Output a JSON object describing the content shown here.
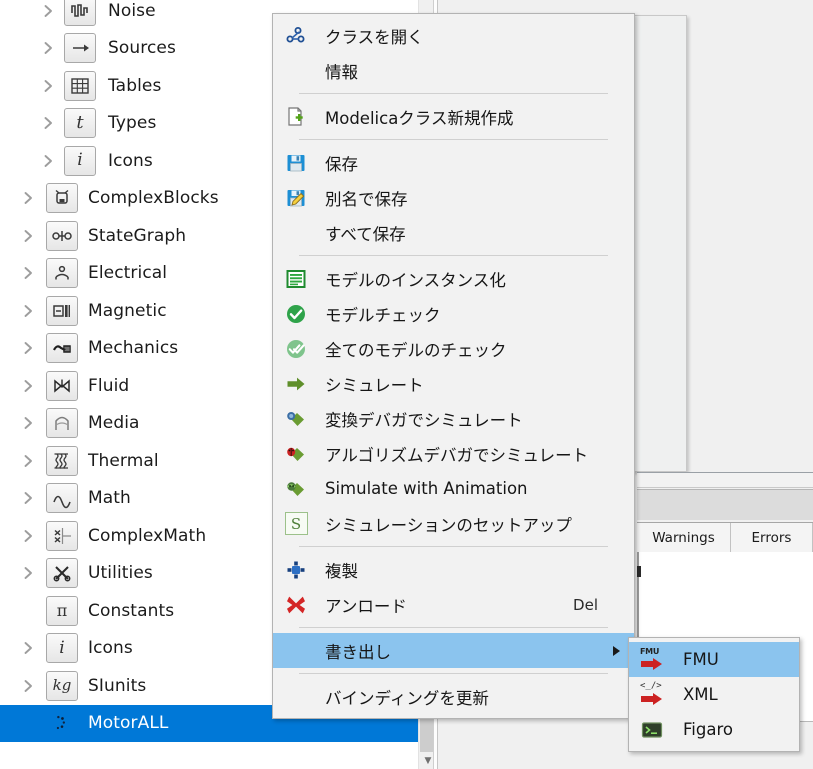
{
  "tree": {
    "items": [
      {
        "label": "Noise",
        "icon": "noise-icon",
        "level": 2,
        "expandable": true,
        "selected": false
      },
      {
        "label": "Sources",
        "icon": "sources-icon",
        "level": 2,
        "expandable": true,
        "selected": false
      },
      {
        "label": "Tables",
        "icon": "tables-icon",
        "level": 2,
        "expandable": true,
        "selected": false
      },
      {
        "label": "Types",
        "icon": "types-icon",
        "level": 2,
        "expandable": true,
        "selected": false
      },
      {
        "label": "Icons",
        "icon": "info-icon",
        "level": 2,
        "expandable": true,
        "selected": false
      },
      {
        "label": "ComplexBlocks",
        "icon": "complexblocks-icon",
        "level": 1,
        "expandable": true,
        "selected": false
      },
      {
        "label": "StateGraph",
        "icon": "stategraph-icon",
        "level": 1,
        "expandable": true,
        "selected": false
      },
      {
        "label": "Electrical",
        "icon": "electrical-icon",
        "level": 1,
        "expandable": true,
        "selected": false
      },
      {
        "label": "Magnetic",
        "icon": "magnetic-icon",
        "level": 1,
        "expandable": true,
        "selected": false
      },
      {
        "label": "Mechanics",
        "icon": "mechanics-icon",
        "level": 1,
        "expandable": true,
        "selected": false
      },
      {
        "label": "Fluid",
        "icon": "fluid-icon",
        "level": 1,
        "expandable": true,
        "selected": false
      },
      {
        "label": "Media",
        "icon": "media-icon",
        "level": 1,
        "expandable": true,
        "selected": false
      },
      {
        "label": "Thermal",
        "icon": "thermal-icon",
        "level": 1,
        "expandable": true,
        "selected": false
      },
      {
        "label": "Math",
        "icon": "math-icon",
        "level": 1,
        "expandable": true,
        "selected": false
      },
      {
        "label": "ComplexMath",
        "icon": "complexmath-icon",
        "level": 1,
        "expandable": true,
        "selected": false
      },
      {
        "label": "Utilities",
        "icon": "utilities-icon",
        "level": 1,
        "expandable": true,
        "selected": false
      },
      {
        "label": "Constants",
        "icon": "pi-icon",
        "level": 1,
        "expandable": false,
        "selected": false
      },
      {
        "label": "Icons",
        "icon": "info-icon",
        "level": 1,
        "expandable": true,
        "selected": false
      },
      {
        "label": "SIunits",
        "icon": "kg-icon",
        "level": 1,
        "expandable": true,
        "selected": false
      },
      {
        "label": "MotorALL",
        "icon": "busy-icon",
        "level": 1,
        "expandable": false,
        "selected": true
      }
    ]
  },
  "context_menu": {
    "items": [
      {
        "type": "item",
        "label": "クラスを開く",
        "icon": "open-class-icon",
        "shortcut": "",
        "submenu": false,
        "highlighted": false
      },
      {
        "type": "item",
        "label": "情報",
        "icon": "none",
        "shortcut": "",
        "submenu": false,
        "highlighted": false
      },
      {
        "type": "separator"
      },
      {
        "type": "item",
        "label": "Modelicaクラス新規作成",
        "icon": "new-modelica-class-icon",
        "shortcut": "",
        "submenu": false,
        "highlighted": false
      },
      {
        "type": "separator"
      },
      {
        "type": "item",
        "label": "保存",
        "icon": "save-icon",
        "shortcut": "",
        "submenu": false,
        "highlighted": false
      },
      {
        "type": "item",
        "label": "別名で保存",
        "icon": "save-as-icon",
        "shortcut": "",
        "submenu": false,
        "highlighted": false
      },
      {
        "type": "item",
        "label": "すべて保存",
        "icon": "none",
        "shortcut": "",
        "submenu": false,
        "highlighted": false
      },
      {
        "type": "separator"
      },
      {
        "type": "item",
        "label": "モデルのインスタンス化",
        "icon": "instantiate-model-icon",
        "shortcut": "",
        "submenu": false,
        "highlighted": false
      },
      {
        "type": "item",
        "label": "モデルチェック",
        "icon": "check-model-icon",
        "shortcut": "",
        "submenu": false,
        "highlighted": false
      },
      {
        "type": "item",
        "label": "全てのモデルのチェック",
        "icon": "check-all-models-icon",
        "shortcut": "",
        "submenu": false,
        "highlighted": false
      },
      {
        "type": "item",
        "label": "シミュレート",
        "icon": "simulate-arrow-icon",
        "shortcut": "",
        "submenu": false,
        "highlighted": false
      },
      {
        "type": "item",
        "label": "変換デバガでシミュレート",
        "icon": "simulate-transformational-debugger-icon",
        "shortcut": "",
        "submenu": false,
        "highlighted": false
      },
      {
        "type": "item",
        "label": "アルゴリズムデバガでシミュレート",
        "icon": "simulate-algorithmic-debugger-icon",
        "shortcut": "",
        "submenu": false,
        "highlighted": false
      },
      {
        "type": "item",
        "label": "Simulate with Animation",
        "icon": "simulate-animation-icon",
        "shortcut": "",
        "submenu": false,
        "highlighted": false
      },
      {
        "type": "item",
        "label": "シミュレーションのセットアップ",
        "icon": "simulation-setup-icon",
        "shortcut": "",
        "submenu": false,
        "highlighted": false
      },
      {
        "type": "separator"
      },
      {
        "type": "item",
        "label": "複製",
        "icon": "duplicate-icon",
        "shortcut": "",
        "submenu": false,
        "highlighted": false
      },
      {
        "type": "item",
        "label": "アンロード",
        "icon": "unload-icon",
        "shortcut": "Del",
        "submenu": false,
        "highlighted": false
      },
      {
        "type": "separator"
      },
      {
        "type": "item",
        "label": "書き出し",
        "icon": "none",
        "shortcut": "",
        "submenu": true,
        "highlighted": true
      },
      {
        "type": "separator"
      },
      {
        "type": "item",
        "label": "バインディングを更新",
        "icon": "none",
        "shortcut": "",
        "submenu": false,
        "highlighted": false
      }
    ]
  },
  "export_submenu": {
    "items": [
      {
        "label": "FMU",
        "icon": "fmu-icon",
        "highlighted": true
      },
      {
        "label": "XML",
        "icon": "xml-icon",
        "highlighted": false
      },
      {
        "label": "Figaro",
        "icon": "figaro-icon",
        "highlighted": false
      }
    ]
  },
  "messages_panel": {
    "columns": [
      {
        "label": "Warnings",
        "width": 94
      },
      {
        "label": "Errors",
        "width": 82
      }
    ]
  },
  "colors": {
    "selection_blue": "#0078d7",
    "menu_highlight": "#8bc4ee",
    "menu_bg": "#f2f2f2",
    "panel_bg": "#f0f0f0"
  }
}
